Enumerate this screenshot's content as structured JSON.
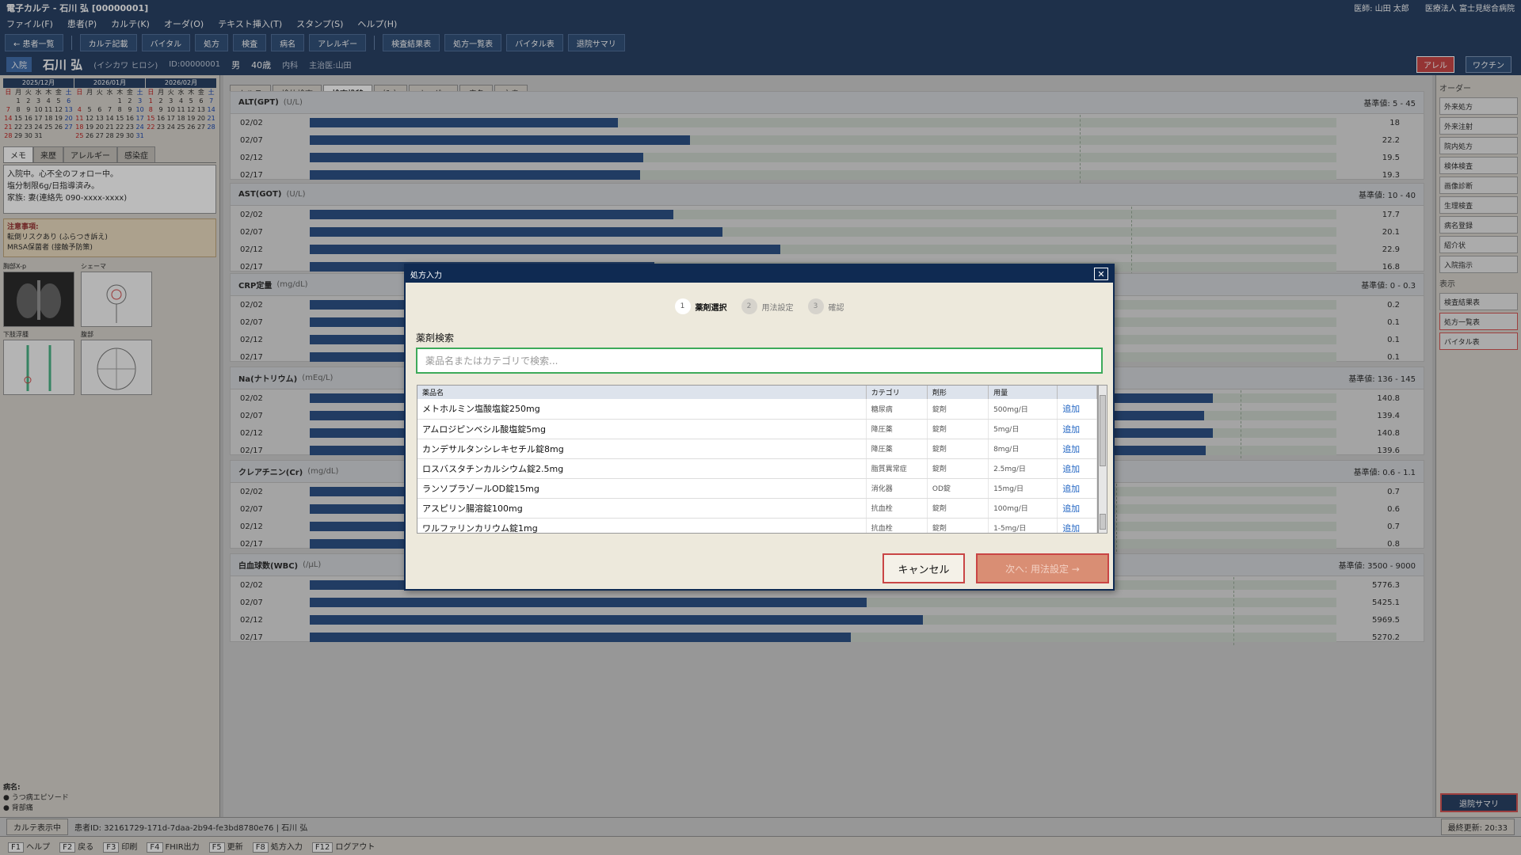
{
  "titlebar": {
    "title": "電子カルテ - 石川 弘 [00000001]",
    "doctor": "医師: 山田 太郎",
    "hospital": "医療法人 富士見総合病院"
  },
  "menu": [
    "ファイル(F)",
    "患者(P)",
    "カルテ(K)",
    "オーダ(O)",
    "テキスト挿入(T)",
    "スタンプ(S)",
    "ヘルプ(H)"
  ],
  "toolbar": [
    "← 患者一覧",
    "カルテ記載",
    "バイタル",
    "処方",
    "検査",
    "病名",
    "アレルギー",
    "検査結果表",
    "処方一覧表",
    "バイタル表",
    "退院サマリ"
  ],
  "patient": {
    "status": "入院",
    "name": "石川 弘",
    "kana": "(イシカワ ヒロシ)",
    "id": "ID:00000001",
    "sex": "男",
    "age": "40歳",
    "dept": "内科",
    "doctor": "主治医:山田",
    "allergy_label": "アレル",
    "vaccine_label": "ワクチン"
  },
  "calendar": [
    {
      "title": "2025/12月",
      "weekdays": [
        "日",
        "月",
        "火",
        "水",
        "木",
        "金",
        "土"
      ],
      "days": [
        "",
        "1",
        "2",
        "3",
        "4",
        "5",
        "6",
        "7",
        "8",
        "9",
        "10",
        "11",
        "12",
        "13",
        "14",
        "15",
        "16",
        "17",
        "18",
        "19",
        "20",
        "21",
        "22",
        "23",
        "24",
        "25",
        "26",
        "27",
        "28",
        "29",
        "30",
        "31",
        "",
        "",
        ""
      ]
    },
    {
      "title": "2026/01月",
      "weekdays": [
        "日",
        "月",
        "火",
        "水",
        "木",
        "金",
        "土"
      ],
      "days": [
        "",
        "",
        "",
        "",
        "1",
        "2",
        "3",
        "4",
        "5",
        "6",
        "7",
        "8",
        "9",
        "10",
        "11",
        "12",
        "13",
        "14",
        "15",
        "16",
        "17",
        "18",
        "19",
        "20",
        "21",
        "22",
        "23",
        "24",
        "25",
        "26",
        "27",
        "28",
        "29",
        "30",
        "31"
      ]
    },
    {
      "title": "2026/02月",
      "weekdays": [
        "日",
        "月",
        "火",
        "水",
        "木",
        "金",
        "土"
      ],
      "days": [
        "1",
        "2",
        "3",
        "4",
        "5",
        "6",
        "7",
        "8",
        "9",
        "10",
        "11",
        "12",
        "13",
        "14",
        "15",
        "16",
        "17",
        "18",
        "19",
        "20",
        "21",
        "22",
        "23",
        "24",
        "25",
        "26",
        "27",
        "28",
        "",
        "",
        "",
        "",
        "",
        "",
        ""
      ]
    }
  ],
  "left_tabs": [
    "メモ",
    "来歴",
    "アレルギー",
    "感染症"
  ],
  "memo": {
    "line1": "入院中。心不全のフォロー中。",
    "line2": "塩分制限6g/日指導済み。",
    "line3": "家族: 妻(連絡先 090-xxxx-xxxx)"
  },
  "caution": {
    "title": "注意事項:",
    "line1": "転倒リスクあり (ふらつき訴え)",
    "line2": "MRSA保菌者 (接触予防策)"
  },
  "images": [
    "胸部X-p",
    "シェーマ",
    "下肢浮腫",
    "腹部"
  ],
  "diagnosis": {
    "title": "病名:",
    "items": [
      "うつ病エピソード",
      "背部痛"
    ]
  },
  "chart_tabs": [
    "カルテ",
    "検体検査",
    "検査推移",
    "処方",
    "オーダー",
    "病名",
    "文書"
  ],
  "lab_panels": [
    {
      "name": "ALT(GPT)",
      "unit": "(U/L)",
      "ref": "基準値: 5 - 45",
      "max": 60,
      "ref_hi": 45,
      "rows": [
        {
          "date": "02/02",
          "value": 18,
          "label": "18"
        },
        {
          "date": "02/07",
          "value": 22.2,
          "label": "22.2"
        },
        {
          "date": "02/12",
          "value": 19.5,
          "label": "19.5"
        },
        {
          "date": "02/17",
          "value": 19.3,
          "label": "19.3"
        }
      ]
    },
    {
      "name": "AST(GOT)",
      "unit": "(U/L)",
      "ref": "基準値: 10 - 40",
      "max": 50,
      "ref_hi": 40,
      "rows": [
        {
          "date": "02/02",
          "value": 17.7,
          "label": "17.7"
        },
        {
          "date": "02/07",
          "value": 20.1,
          "label": "20.1"
        },
        {
          "date": "02/12",
          "value": 22.9,
          "label": "22.9"
        },
        {
          "date": "02/17",
          "value": 16.8,
          "label": "16.8"
        }
      ]
    },
    {
      "name": "CRP定量",
      "unit": "(mg/dL)",
      "ref": "基準値: 0 - 0.3",
      "max": 0.4,
      "ref_hi": 0.3,
      "rows": [
        {
          "date": "02/02",
          "value": 0.2,
          "label": "0.2"
        },
        {
          "date": "02/07",
          "value": 0.1,
          "label": "0.1"
        },
        {
          "date": "02/12",
          "value": 0.1,
          "label": "0.1"
        },
        {
          "date": "02/17",
          "value": 0.1,
          "label": "0.1"
        }
      ]
    },
    {
      "name": "Na(ナトリウム)",
      "unit": "(mEq/L)",
      "ref": "基準値: 136 - 145",
      "max": 160,
      "ref_hi": 145,
      "rows": [
        {
          "date": "02/02",
          "value": 140.8,
          "label": "140.8"
        },
        {
          "date": "02/07",
          "value": 139.4,
          "label": "139.4"
        },
        {
          "date": "02/12",
          "value": 140.8,
          "label": "140.8"
        },
        {
          "date": "02/17",
          "value": 139.6,
          "label": "139.6"
        }
      ]
    },
    {
      "name": "クレアチニン(Cr)",
      "unit": "(mg/dL)",
      "ref": "基準値: 0.6 - 1.1",
      "max": 1.4,
      "ref_hi": 1.1,
      "rows": [
        {
          "date": "02/02",
          "value": 0.7,
          "label": "0.7"
        },
        {
          "date": "02/07",
          "value": 0.6,
          "label": "0.6"
        },
        {
          "date": "02/12",
          "value": 0.7,
          "label": "0.7"
        },
        {
          "date": "02/17",
          "value": 0.8,
          "label": "0.8"
        }
      ]
    },
    {
      "name": "白血球数(WBC)",
      "unit": "(/μL)",
      "ref": "基準値: 3500 - 9000",
      "max": 10000,
      "ref_hi": 9000,
      "rows": [
        {
          "date": "02/02",
          "value": 5776.3,
          "label": "5776.3"
        },
        {
          "date": "02/07",
          "value": 5425.1,
          "label": "5425.1"
        },
        {
          "date": "02/12",
          "value": 5969.5,
          "label": "5969.5"
        },
        {
          "date": "02/17",
          "value": 5270.2,
          "label": "5270.2"
        }
      ]
    }
  ],
  "right_panel": {
    "order_title": "オーダー",
    "orders": [
      "外来処方",
      "外来注射",
      "院内処方",
      "検体検査",
      "画像診断",
      "生理検査",
      "病名登録",
      "紹介状",
      "入院指示"
    ],
    "view_title": "表示",
    "views": [
      "検査結果表",
      "処方一覧表",
      "バイタル表"
    ],
    "discharge": "退院サマリ"
  },
  "statusbar": {
    "mode": "カルテ表示中",
    "patient_id": "患者ID: 32161729-171d-7daa-2b94-fe3bd8780e76 | 石川 弘",
    "updated": "最終更新: 20:33"
  },
  "fkeys": [
    {
      "key": "F1",
      "label": "ヘルプ"
    },
    {
      "key": "F2",
      "label": "戻る"
    },
    {
      "key": "F3",
      "label": "印刷"
    },
    {
      "key": "F4",
      "label": "FHIR出力"
    },
    {
      "key": "F5",
      "label": "更新"
    },
    {
      "key": "F8",
      "label": "処方入力"
    },
    {
      "key": "F12",
      "label": "ログアウト"
    }
  ],
  "dialog": {
    "title": "処方入力",
    "close": "✕",
    "steps": [
      {
        "num": "1",
        "label": "薬剤選択"
      },
      {
        "num": "2",
        "label": "用法設定"
      },
      {
        "num": "3",
        "label": "確認"
      }
    ],
    "search_label": "薬剤検索",
    "search_placeholder": "薬品名またはカテゴリで検索...",
    "columns": [
      "薬品名",
      "カテゴリ",
      "剤形",
      "用量",
      ""
    ],
    "drugs": [
      {
        "name": "メトホルミン塩酸塩錠250mg",
        "category": "糖尿病",
        "form": "錠剤",
        "dose": "500mg/日",
        "action": "追加"
      },
      {
        "name": "アムロジピンベシル酸塩錠5mg",
        "category": "降圧薬",
        "form": "錠剤",
        "dose": "5mg/日",
        "action": "追加"
      },
      {
        "name": "カンデサルタンシレキセチル錠8mg",
        "category": "降圧薬",
        "form": "錠剤",
        "dose": "8mg/日",
        "action": "追加"
      },
      {
        "name": "ロスバスタチンカルシウム錠2.5mg",
        "category": "脂質異常症",
        "form": "錠剤",
        "dose": "2.5mg/日",
        "action": "追加"
      },
      {
        "name": "ランソプラゾールOD錠15mg",
        "category": "消化器",
        "form": "OD錠",
        "dose": "15mg/日",
        "action": "追加"
      },
      {
        "name": "アスピリン腸溶錠100mg",
        "category": "抗血栓",
        "form": "錠剤",
        "dose": "100mg/日",
        "action": "追加"
      },
      {
        "name": "ワルファリンカリウム錠1mg",
        "category": "抗血栓",
        "form": "錠剤",
        "dose": "1-5mg/日",
        "action": "追加"
      }
    ],
    "cancel": "キャンセル",
    "next": "次へ: 用法設定 →"
  }
}
